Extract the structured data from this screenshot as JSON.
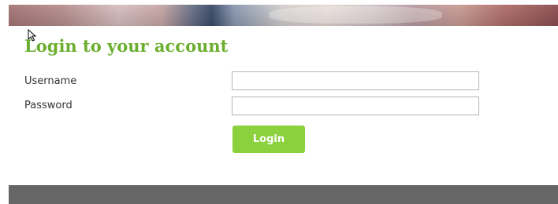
{
  "banner": {
    "image": "hero-banner"
  },
  "cursor": {
    "icon": "mouse-pointer-icon"
  },
  "login": {
    "title": "Login to your account",
    "username_label": "Username",
    "username_value": "",
    "password_label": "Password",
    "password_value": "",
    "button_label": "Login"
  },
  "colors": {
    "title": "#6cae2f",
    "button": "#8bd13d",
    "footer": "#666666"
  }
}
